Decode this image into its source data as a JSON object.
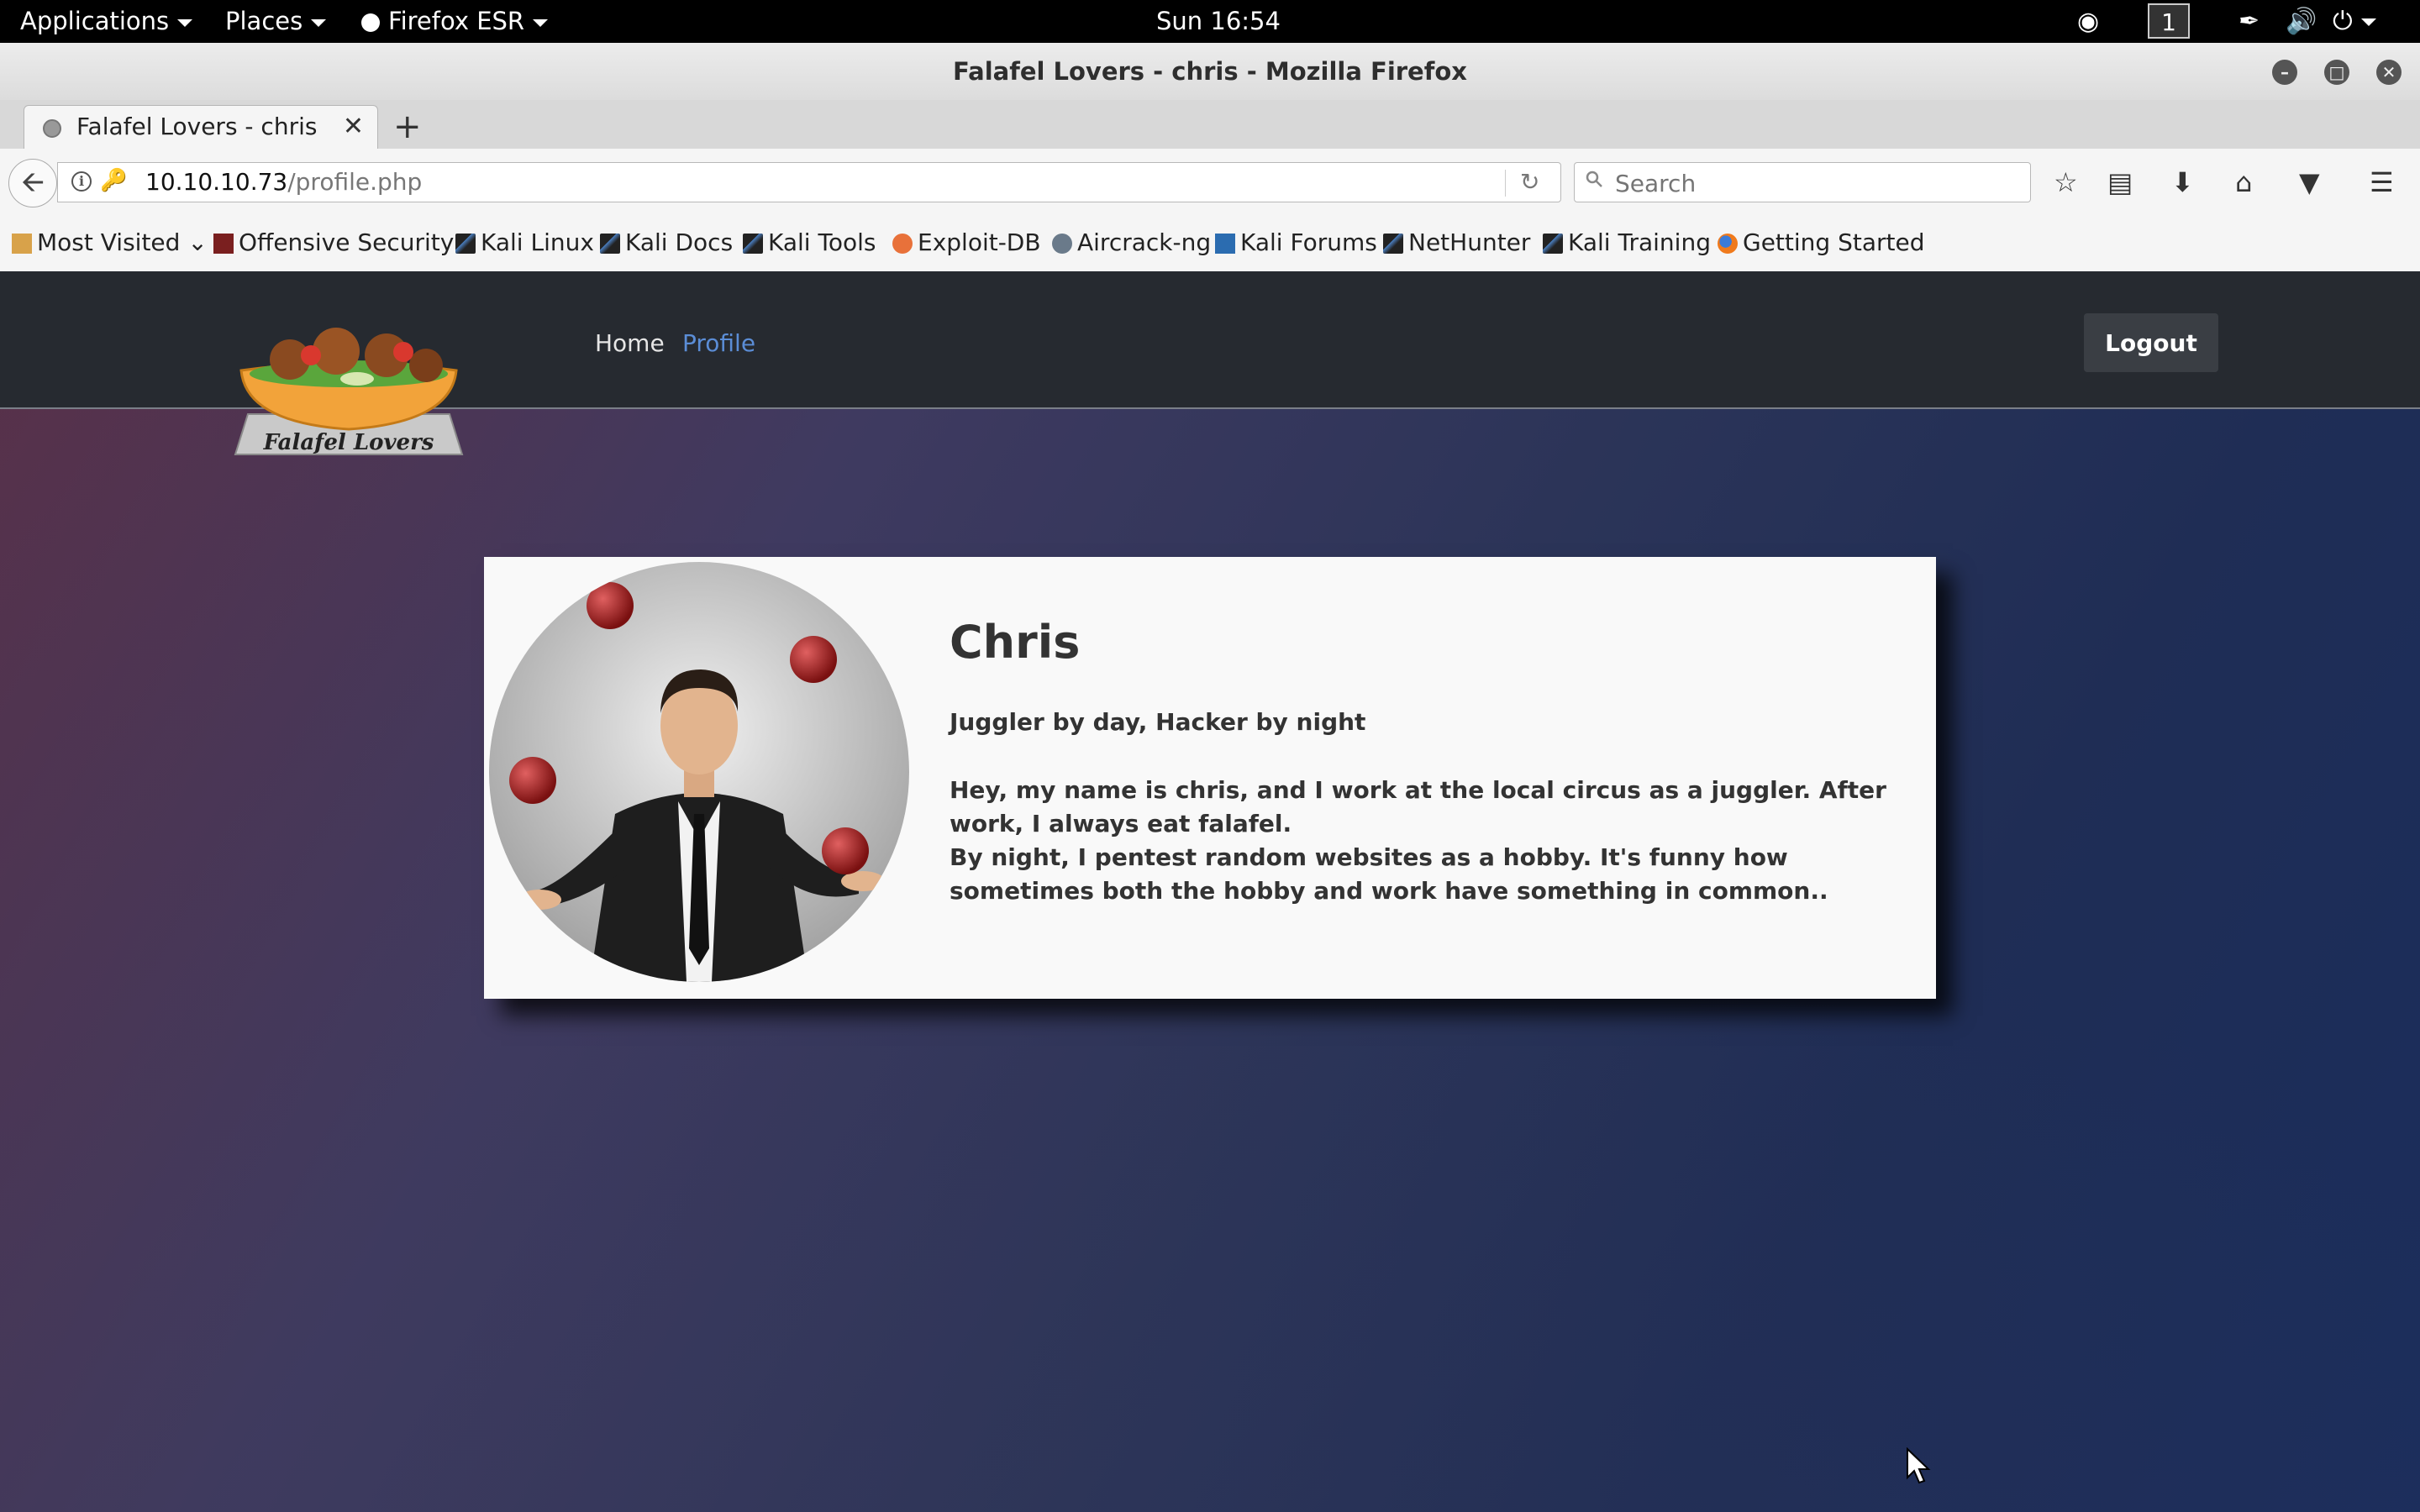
{
  "system_bar": {
    "applications": "Applications",
    "places": "Places",
    "firefox_menu": "Firefox ESR",
    "clock": "Sun 16:54",
    "workspace": "1"
  },
  "window": {
    "title": "Falafel Lovers - chris - Mozilla Firefox"
  },
  "tabs": [
    {
      "label": "Falafel Lovers - chris",
      "active": true
    }
  ],
  "address_bar": {
    "host": "10.10.10.73",
    "path": "/profile.php"
  },
  "search_bar": {
    "placeholder": "Search"
  },
  "bookmarks": [
    "Most Visited",
    "Offensive Security",
    "Kali Linux",
    "Kali Docs",
    "Kali Tools",
    "Exploit-DB",
    "Aircrack-ng",
    "Kali Forums",
    "NetHunter",
    "Kali Training",
    "Getting Started"
  ],
  "site": {
    "logo_text": "Falafel Lovers",
    "nav": {
      "home": "Home",
      "profile": "Profile"
    },
    "logout_label": "Logout",
    "colors": {
      "active_link": "#5b8dd6",
      "link": "#e6e6e6",
      "navbar": "#262a30"
    }
  },
  "profile": {
    "name": "Chris",
    "tagline": "Juggler by day, Hacker by night",
    "bio_line1": "Hey, my name is chris, and I work at the local circus as a juggler. After work, I always eat falafel.",
    "bio_line2": "By night, I pentest random websites as a hobby. It's funny how sometimes both the hobby and work have something in common.."
  }
}
